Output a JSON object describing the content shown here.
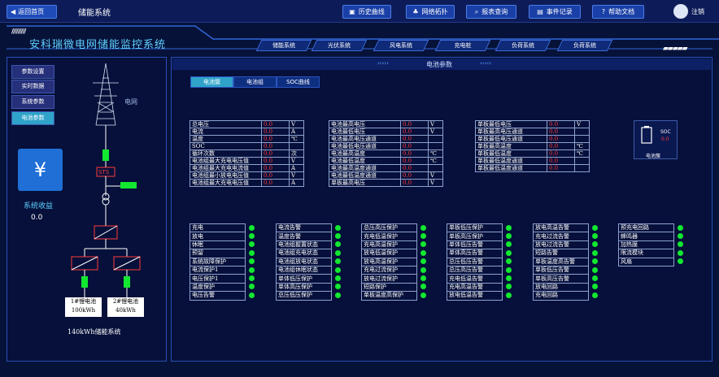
{
  "topbar": {
    "home": "返回首页",
    "system": "储能系统",
    "buttons": [
      "历史曲线",
      "网络拓扑",
      "报表查询",
      "事件记录",
      "帮助文档"
    ],
    "logout": "注销"
  },
  "header": {
    "title": "安科瑞微电网储能监控系统",
    "tabs": [
      "储能系统",
      "光伏系统",
      "风电系统",
      "充电桩",
      "负荷系统",
      "负荷系统"
    ]
  },
  "sidebar": {
    "items": [
      "参数设置",
      "实时数据",
      "系统参数",
      "电池参数"
    ],
    "grid_label": "电网",
    "sts": "STS",
    "revenue_label": "系统收益",
    "revenue_value": "0.0",
    "battery1": [
      "1#锂电池",
      "100kWh"
    ],
    "battery2": [
      "2#锂电池",
      "40kWh"
    ],
    "footer": "140kWh储能系统"
  },
  "main": {
    "title": "电池参数",
    "subtabs": [
      "电池簇",
      "电池组",
      "SOC曲线"
    ]
  },
  "params1": [
    [
      "总电压",
      "0.0",
      "V"
    ],
    [
      "电流",
      "0.0",
      "A"
    ],
    [
      "温度",
      "0.0",
      "℃"
    ],
    [
      "SOC",
      "0.0",
      ""
    ],
    [
      "循环次数",
      "0.0",
      "次"
    ],
    [
      "电池组最大充电电压值",
      "0.0",
      "V"
    ],
    [
      "电池组最大充电电流值",
      "0.0",
      "A"
    ],
    [
      "电池组最小放电电压值",
      "0.0",
      "V"
    ],
    [
      "电池组最大充电电压值",
      "0.0",
      "A"
    ]
  ],
  "params2": [
    [
      "电池最高电压",
      "0.0",
      "V"
    ],
    [
      "电池最低电压",
      "0.0",
      "V"
    ],
    [
      "电池最高电压通道",
      "0.0",
      ""
    ],
    [
      "电池最低电压通道",
      "0.0",
      ""
    ],
    [
      "电池最高温度",
      "0.0",
      "℃"
    ],
    [
      "电池最低温度",
      "0.0",
      "℃"
    ],
    [
      "电池最高温度通道",
      "0.0",
      ""
    ],
    [
      "电池最低温度通道",
      "0.0",
      "V"
    ],
    [
      "单板最高电压",
      "0.0",
      "V"
    ]
  ],
  "params3": [
    [
      "单板最低电压",
      "0.0",
      "V"
    ],
    [
      "单板最高电压通道",
      "0.0",
      ""
    ],
    [
      "单板最低电压通道",
      "0.0",
      ""
    ],
    [
      "单板最高温度",
      "0.0",
      "℃"
    ],
    [
      "单板最低温度",
      "0.0",
      "℃"
    ],
    [
      "单板最低温度通道",
      "0.0",
      ""
    ],
    [
      "单板最低温度通道",
      "0.0",
      ""
    ]
  ],
  "soc": {
    "label": "SOC",
    "value": "0.0",
    "caption": "电池簇"
  },
  "status1": [
    "充电",
    "放电",
    "休眠",
    "预留",
    "系统故障保护",
    "电流保护1",
    "电压保护1",
    "温度保护",
    "电压告警"
  ],
  "status2": [
    "电流告警",
    "温度告警",
    "电池组握置状态",
    "电池组充电状态",
    "电池组放电状态",
    "电池组休眠状态",
    "单体低压保护",
    "单体高压保护",
    "总压低压保护"
  ],
  "status3": [
    "总压高压保护",
    "充电低温保护",
    "充电高温保护",
    "放电低温保护",
    "放电高温保护",
    "充电过流保护",
    "放电过流保护",
    "短路保护",
    "单板温度高保护"
  ],
  "status4": [
    "单板低压保护",
    "单板高压保护",
    "单体低压告警",
    "单体高压告警",
    "总压低压告警",
    "总压高压告警",
    "充电低温告警",
    "充电高温告警",
    "放电低温告警"
  ],
  "status5": [
    "放电高温告警",
    "充电过流告警",
    "放电过流告警",
    "短路告警",
    "单板温度高告警",
    "单板低压告警",
    "单板高压告警",
    "放电回路",
    "充电回路"
  ],
  "status6": [
    "预充电回路",
    "蜂鸣器",
    "加热膜",
    "限流模块",
    "风扇"
  ],
  "colors": {
    "accent": "#2fa3c9",
    "ok": "#12e830",
    "value": "#ff3b3b"
  }
}
